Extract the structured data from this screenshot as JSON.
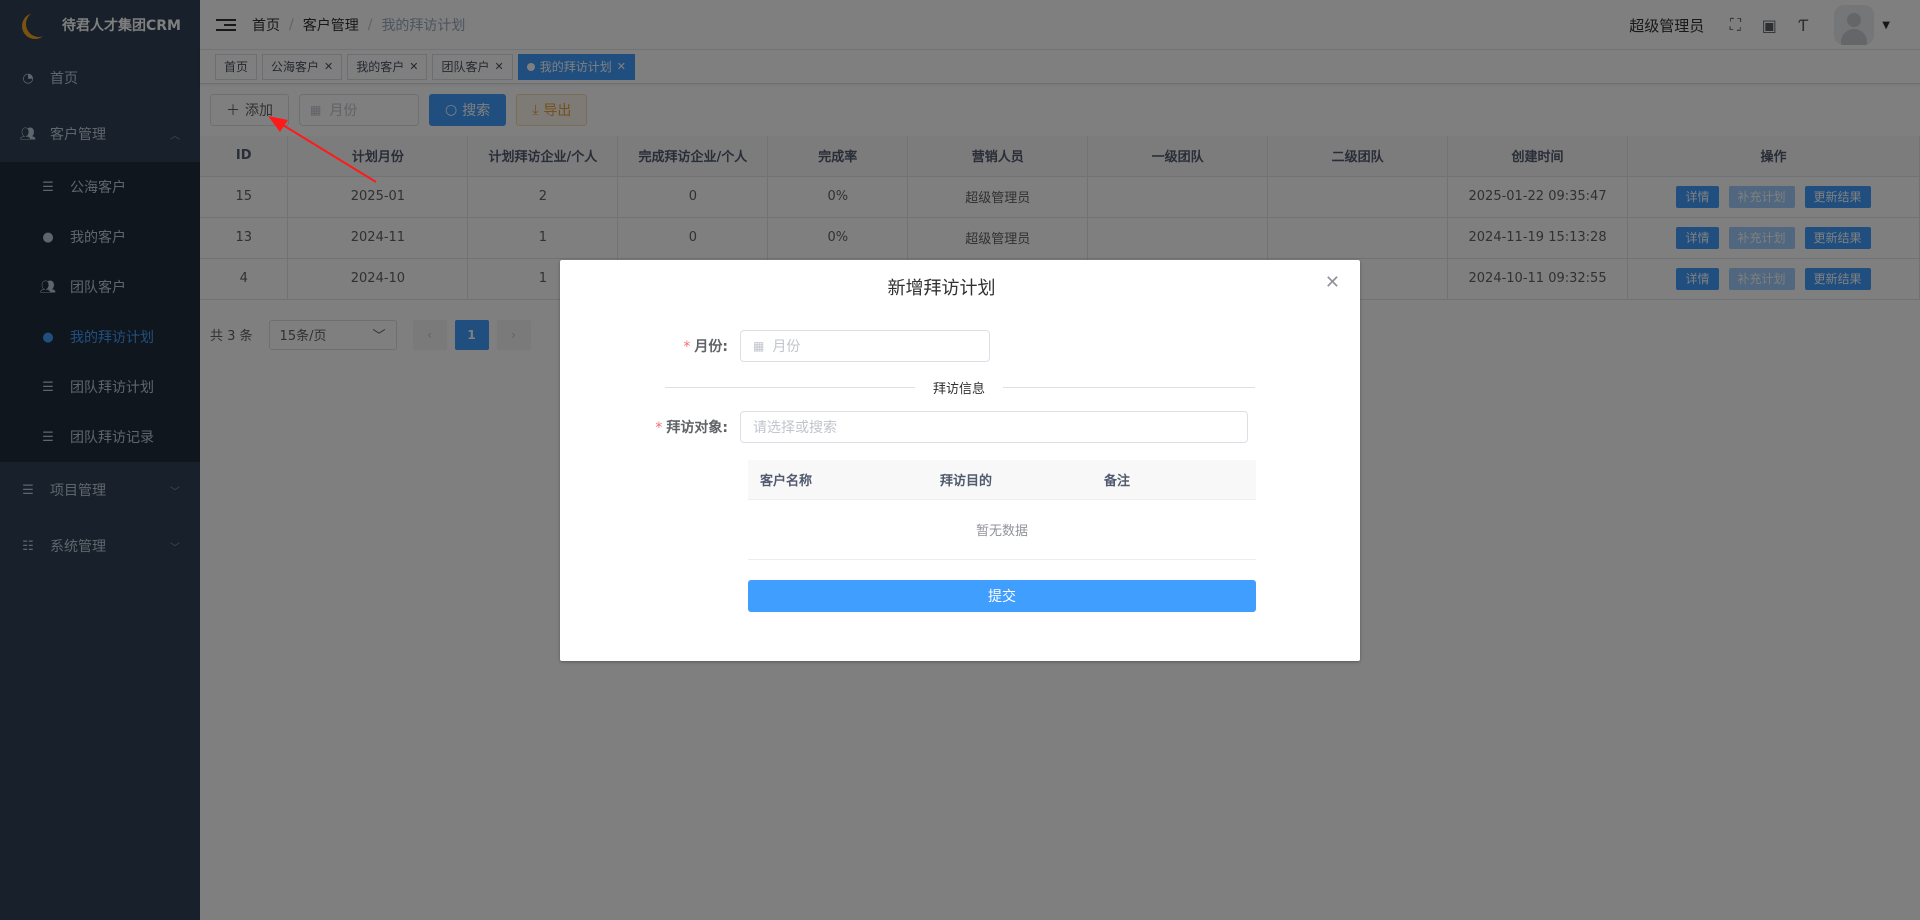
{
  "app": {
    "title": "待君人才集团CRM"
  },
  "sidebar": {
    "items": [
      {
        "label": "首页"
      },
      {
        "label": "客户管理"
      },
      {
        "label": "项目管理"
      },
      {
        "label": "系统管理"
      }
    ],
    "sub": [
      {
        "label": "公海客户"
      },
      {
        "label": "我的客户"
      },
      {
        "label": "团队客户"
      },
      {
        "label": "我的拜访计划"
      },
      {
        "label": "团队拜访计划"
      },
      {
        "label": "团队拜访记录"
      }
    ]
  },
  "navbar": {
    "breadcrumb": [
      "首页",
      "客户管理",
      "我的拜访计划"
    ],
    "user": "超级管理员"
  },
  "tags": [
    "首页",
    "公海客户",
    "我的客户",
    "团队客户",
    "我的拜访计划"
  ],
  "toolbar": {
    "add": "添加",
    "month_placeholder": "月份",
    "search": "搜索",
    "export": "导出"
  },
  "table": {
    "headers": [
      "ID",
      "计划月份",
      "计划拜访企业/个人",
      "完成拜访企业/个人",
      "完成率",
      "营销人员",
      "一级团队",
      "二级团队",
      "创建时间",
      "操作"
    ],
    "rows": [
      {
        "id": "15",
        "month": "2025-01",
        "planned": "2",
        "done": "0",
        "rate": "0%",
        "sales": "超级管理员",
        "team1": "",
        "team2": "",
        "created": "2025-01-22 09:35:47"
      },
      {
        "id": "13",
        "month": "2024-11",
        "planned": "1",
        "done": "0",
        "rate": "0%",
        "sales": "超级管理员",
        "team1": "",
        "team2": "",
        "created": "2024-11-19 15:13:28"
      },
      {
        "id": "4",
        "month": "2024-10",
        "planned": "1",
        "done": "",
        "rate": "",
        "sales": "",
        "team1": "",
        "team2": "",
        "created": "2024-10-11 09:32:55"
      }
    ],
    "ops": [
      "详情",
      "补充计划",
      "更新结果"
    ]
  },
  "pager": {
    "total": "共 3 条",
    "size": "15条/页",
    "page": "1"
  },
  "dialog": {
    "title": "新增拜访计划",
    "month_label": "月份:",
    "month_placeholder": "月份",
    "divider": "拜访信息",
    "target_label": "拜访对象:",
    "target_placeholder": "请选择或搜索",
    "inner_headers": [
      "客户名称",
      "拜访目的",
      "备注"
    ],
    "empty": "暂无数据",
    "submit": "提交"
  }
}
